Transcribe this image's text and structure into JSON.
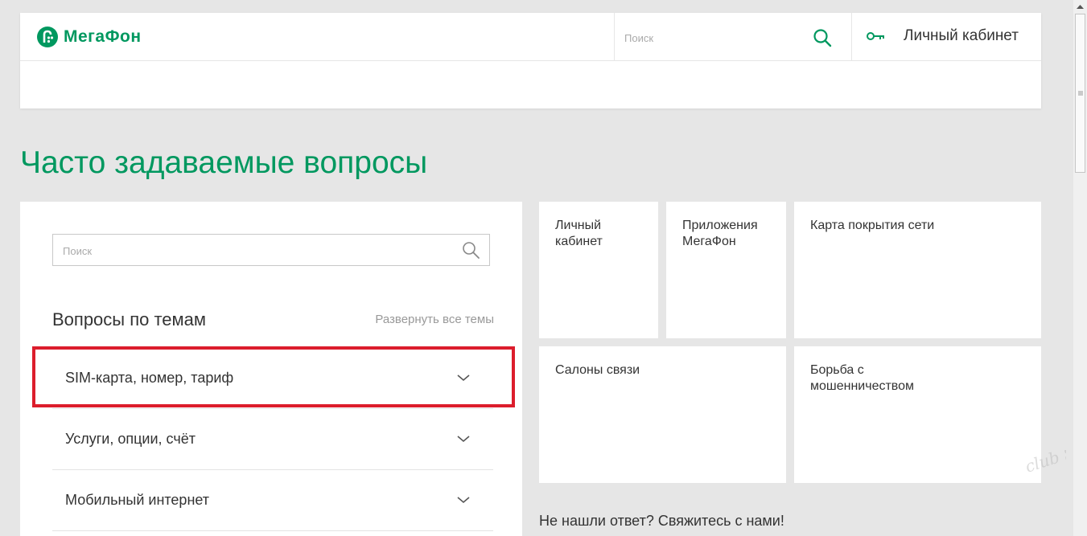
{
  "header": {
    "logo_text": "МегаФон",
    "search_placeholder": "Поиск",
    "cabinet_label": "Личный кабинет"
  },
  "page": {
    "title": "Часто задаваемые вопросы"
  },
  "faq": {
    "search_placeholder": "Поиск",
    "topics_title": "Вопросы по темам",
    "expand_all": "Развернуть все темы",
    "topics": [
      {
        "label": "SIM-карта, номер, тариф"
      },
      {
        "label": "Услуги, опции, счёт"
      },
      {
        "label": "Мобильный интернет"
      }
    ]
  },
  "tiles": [
    {
      "label": "Личный\nкабинет"
    },
    {
      "label": "Приложения\nМегаФон"
    },
    {
      "label": "Карта покрытия сети"
    },
    {
      "label": "Салоны связи"
    },
    {
      "label": "Борьба с\nмошенничеством"
    }
  ],
  "contact": {
    "text": "Не нашли ответ? Свяжитесь с нами!"
  },
  "watermark": {
    "text": "club Sovet"
  },
  "colors": {
    "brand_green": "#00985f",
    "highlight_red": "#dc1d2c",
    "page_background": "#e6e6e6"
  },
  "icons": {
    "logo": "megafon-logo-icon",
    "search": "search-icon",
    "key": "key-icon",
    "chevron": "chevron-down-icon"
  }
}
